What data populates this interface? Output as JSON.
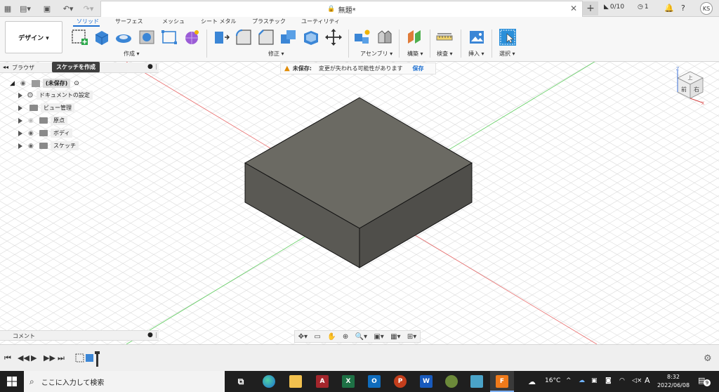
{
  "window": {
    "doc_title": "無題*",
    "jobs": "0/10",
    "notifications_count": "1",
    "user_initials": "KS"
  },
  "toolbar": {
    "design_label": "デザイン ▾",
    "tabs": [
      "ソリッド",
      "サーフェス",
      "メッシュ",
      "シート メタル",
      "プラスチック",
      "ユーティリティ"
    ],
    "groups": {
      "create": "作成 ▾",
      "modify": "修正 ▾",
      "assemble": "アセンブリ ▾",
      "construct": "構築 ▾",
      "inspect": "検査 ▾",
      "insert": "挿入 ▾",
      "select": "選択 ▾"
    }
  },
  "browser": {
    "title": "ブラウザ",
    "tooltip": "スケッチを作成",
    "root": "(未保存)",
    "items": [
      "ドキュメントの設定",
      "ビュー管理",
      "原点",
      "ボディ",
      "スケッチ"
    ]
  },
  "banner": {
    "label": "未保存:",
    "message": "変更が失われる可能性があります",
    "action": "保存"
  },
  "comments": {
    "label": "コメント"
  },
  "viewcube": {
    "front": "前",
    "right": "右",
    "top": "上",
    "z": "Z",
    "x": "X"
  },
  "taskbar": {
    "search_placeholder": "ここに入力して検索",
    "weather": "16°C",
    "ime": "A",
    "time": "8:32",
    "date": "2022/06/08",
    "notif_count": "9"
  },
  "colors": {
    "accent": "#1d6fd1",
    "body_top": "#6b6a63",
    "body_left": "#5a5954",
    "body_right": "#4f4e4a",
    "axis_red": "#e86a6a",
    "axis_green": "#5fce5f"
  }
}
